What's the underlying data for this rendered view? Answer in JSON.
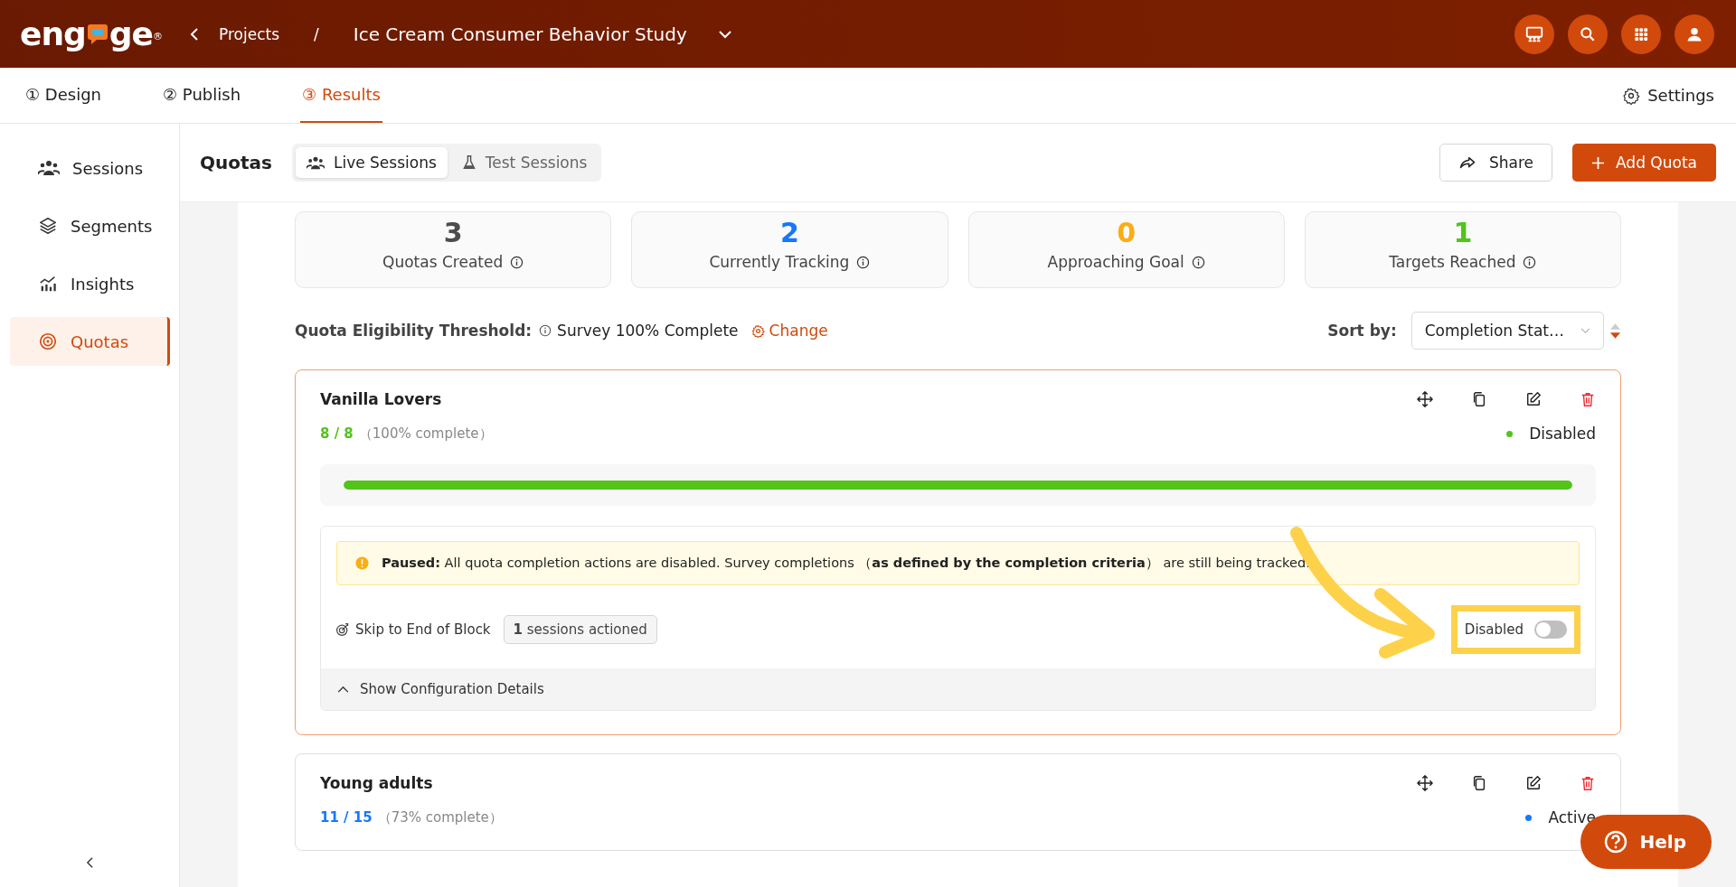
{
  "header": {
    "logo_start": "eng",
    "logo_end": "ge",
    "logo_mark": "®",
    "back_link": "Projects",
    "separator": "/",
    "project": "Ice Cream Consumer Behavior Study"
  },
  "steps": [
    {
      "number": "①",
      "label": "Design",
      "selected": false
    },
    {
      "number": "②",
      "label": "Publish",
      "selected": false
    },
    {
      "number": "③",
      "label": "Results",
      "selected": true
    }
  ],
  "settings": "Settings",
  "sidebar": {
    "items": [
      {
        "kind": "sessions",
        "label": "Sessions",
        "selected": false
      },
      {
        "kind": "segments",
        "label": "Segments",
        "selected": false
      },
      {
        "kind": "insights",
        "label": "Insights",
        "selected": false
      },
      {
        "kind": "quotas",
        "label": "Quotas",
        "selected": true
      }
    ]
  },
  "toolbar": {
    "title": "Quotas",
    "segments": [
      {
        "kind": "live",
        "label": "Live Sessions",
        "selected": true
      },
      {
        "kind": "test",
        "label": "Test Sessions",
        "selected": false
      }
    ],
    "share": "Share",
    "add": "Add Quota"
  },
  "stats": [
    {
      "value": "3",
      "label": "Quotas Created",
      "color": "#4d4d4d"
    },
    {
      "value": "2",
      "label": "Currently Tracking",
      "color": "#1677ff"
    },
    {
      "value": "0",
      "label": "Approaching Goal",
      "color": "#faad14"
    },
    {
      "value": "1",
      "label": "Targets Reached",
      "color": "#52c41a"
    }
  ],
  "threshold": {
    "label": "Quota Eligibility Threshold:",
    "value": "Survey 100% Complete",
    "action": "Change"
  },
  "sort": {
    "label": "Sort by:",
    "value": "Completion Stat…"
  },
  "quotas": [
    {
      "name": "Vanilla Lovers",
      "count": "8 / 8",
      "percent": "（100% complete）",
      "status": "Disabled",
      "color": "#52c41a",
      "selected": true,
      "level": 1,
      "notice": "**Paused:** All quota completion actions are disabled. Survey completions （**as defined by the completion criteria**） are still being tracked.",
      "action": "Skip to End of Block",
      "sessions_count": "1",
      "sessions_label": "sessions actioned",
      "toggle_label": "Disabled",
      "toggle_on": false,
      "details": "Show Configuration Details"
    },
    {
      "name": "Young adults",
      "count": "11 / 15",
      "percent": "（73% complete）",
      "status": "Active",
      "color": "#1677ff",
      "selected": false
    }
  ],
  "help": "Help"
}
